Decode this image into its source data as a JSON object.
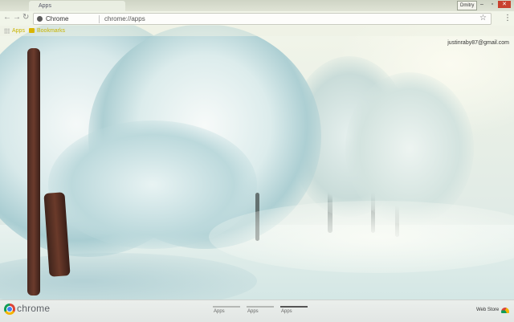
{
  "window": {
    "user_chip": "Dmitry",
    "min_symbol": "–",
    "max_symbol": "▫",
    "close_symbol": "✕"
  },
  "tab": {
    "title": "Apps"
  },
  "omnibox": {
    "site_label": "Chrome",
    "url": "chrome://apps",
    "star_symbol": "☆",
    "menu_symbol": "⋮"
  },
  "nav": {
    "back_symbol": "←",
    "forward_symbol": "→",
    "reload_symbol": "↻"
  },
  "bookmarks": {
    "apps_label": "Apps",
    "bookmarks_label": "Bookmarks"
  },
  "account": {
    "email": "justinraby87@gmail.com"
  },
  "bottom": {
    "brand": "chrome",
    "pages": [
      {
        "label": "Apps",
        "active": false
      },
      {
        "label": "Apps",
        "active": false
      },
      {
        "label": "Apps",
        "active": true
      }
    ],
    "webstore_label": "Web Store"
  },
  "colors": {
    "close": "#c8412e",
    "bookmark_text": "#c8b400",
    "active_page": "#555555"
  },
  "icons": [
    "chrome-favicon",
    "apps-grid-icon",
    "folder-icon",
    "star-icon",
    "menu-icon",
    "chrome-logo-icon",
    "webstore-icon"
  ]
}
